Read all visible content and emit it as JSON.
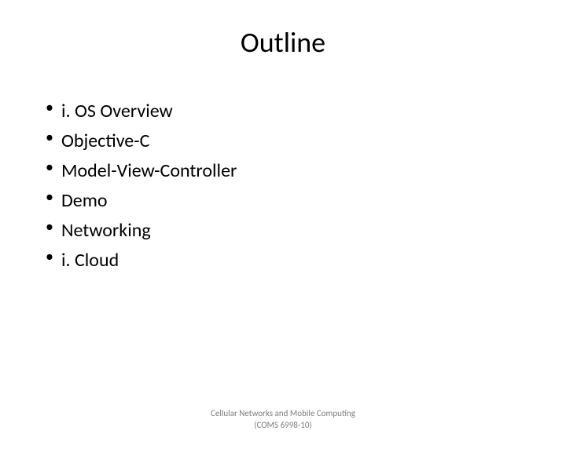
{
  "title": "Outline",
  "bullets": {
    "0": "i. OS Overview",
    "1": "Objective-C",
    "2": "Model-View-Controller",
    "3": "Demo",
    "4": "Networking",
    "5": "i. Cloud"
  },
  "footer": {
    "line1": "Cellular Networks and Mobile Computing",
    "line2": "(COMS 6998-10)"
  }
}
